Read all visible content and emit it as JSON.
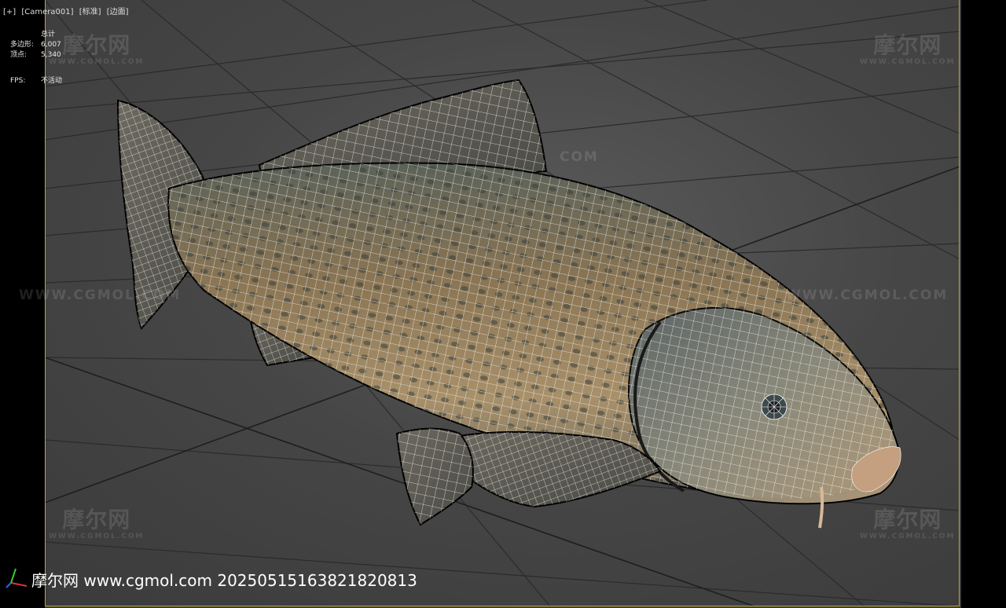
{
  "viewport": {
    "labels": [
      "[+]",
      "[Camera001]",
      "[标准]",
      "[边面]"
    ]
  },
  "stats": {
    "title": "总计",
    "polys_label": "多边形:",
    "polys_value": "6,007",
    "verts_label": "顶点:",
    "verts_value": "5,340",
    "fps_label": "FPS:",
    "fps_value": "不活动"
  },
  "watermarks": {
    "logo_text": "摩尔网",
    "logo_sub": "WWW.CGMOL.COM",
    "line_text": "WWW.CGMOL.COM",
    "partial_text": "COM"
  },
  "footer": {
    "text": "摩尔网 www.cgmol.com 20250515163821820813"
  },
  "colors": {
    "safe_frame": "#b8a63a",
    "grid": "#2a2a2a",
    "wire": "#ffffff"
  }
}
